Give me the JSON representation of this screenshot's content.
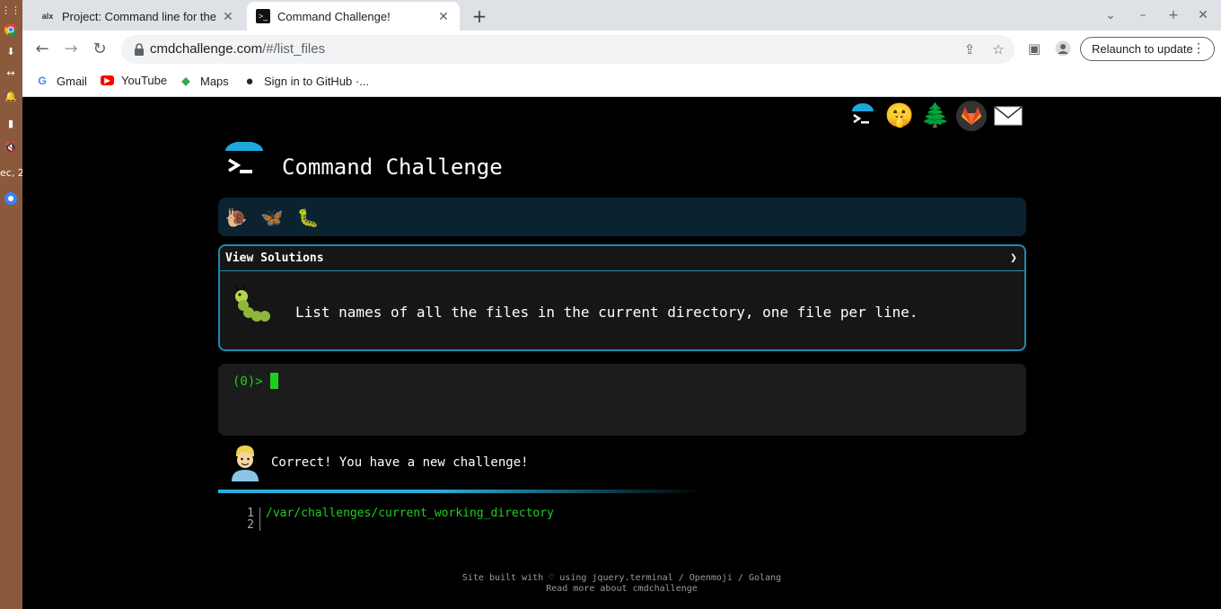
{
  "dock": {
    "date_fragment": "ec, 2"
  },
  "browser": {
    "tabs": [
      {
        "favicon_text": "alx",
        "title": "Project: Command line for the"
      },
      {
        "favicon_text": ">_",
        "title": "Command Challenge!"
      }
    ],
    "url_host": "cmdchallenge.com",
    "url_path": "/#/list_files",
    "relaunch_label": "Relaunch to update",
    "bookmarks": [
      {
        "icon": "G",
        "label": "Gmail"
      },
      {
        "icon": "▶",
        "label": "YouTube"
      },
      {
        "icon": "◆",
        "label": "Maps"
      },
      {
        "icon": "●",
        "label": "Sign in to GitHub ·..."
      }
    ]
  },
  "site": {
    "title": "Command Challenge",
    "top_icons": [
      "cmd-logo-icon",
      "shushing-face-icon",
      "tree-icon",
      "gitlab-icon",
      "mail-icon"
    ]
  },
  "challenge": {
    "view_solutions_label": "View Solutions",
    "chevron": "❯",
    "text": "List names of all the files in the current directory, one file per line."
  },
  "terminal": {
    "prompt": "(0)>"
  },
  "feedback": {
    "text": "Correct! You have a new challenge!"
  },
  "output": {
    "lines": [
      {
        "num": "1",
        "text": "/var/challenges/current_working_directory"
      },
      {
        "num": "2",
        "text": ""
      }
    ]
  },
  "footer": {
    "line1_prefix": "Site built with",
    "heart": "♡",
    "line1_suffix": "using jquery.terminal / Openmoji / Golang",
    "line2": "Read more about cmdchallenge"
  },
  "colors": {
    "accent": "#1e8cab",
    "terminal_green": "#1fcf1f",
    "progress_bg": "#0b2330"
  }
}
